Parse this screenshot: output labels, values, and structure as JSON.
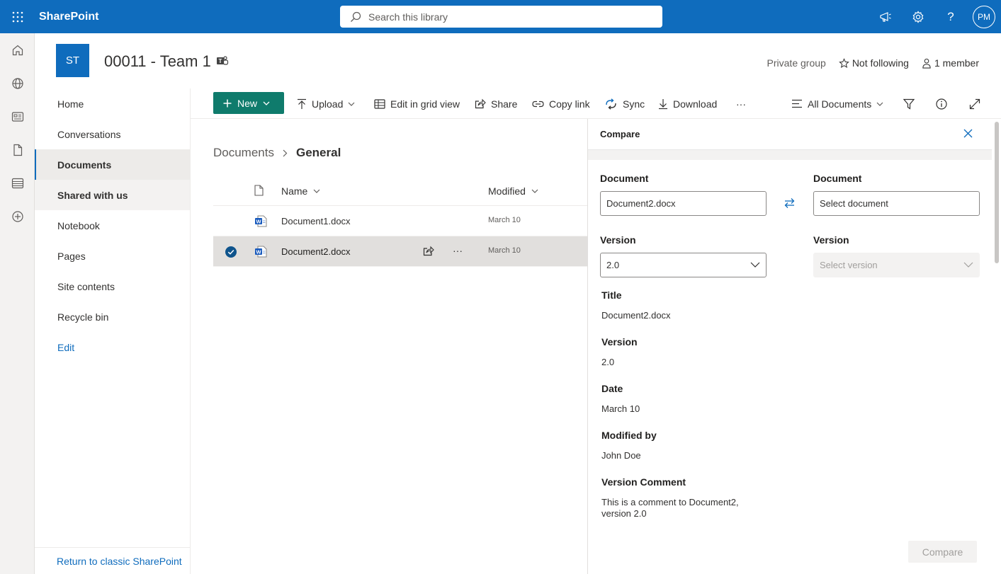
{
  "topbar": {
    "brand": "SharePoint",
    "search_placeholder": "Search this library",
    "user_initials": "PM"
  },
  "site": {
    "logo_initials": "ST",
    "title": "00011 - Team 1",
    "privacy": "Private group",
    "follow": "Not following",
    "members": "1 member"
  },
  "nav": {
    "items": [
      {
        "label": "Home"
      },
      {
        "label": "Conversations"
      },
      {
        "label": "Documents"
      },
      {
        "label": "Shared with us"
      },
      {
        "label": "Notebook"
      },
      {
        "label": "Pages"
      },
      {
        "label": "Site contents"
      },
      {
        "label": "Recycle bin"
      }
    ],
    "edit": "Edit",
    "classic": "Return to classic SharePoint"
  },
  "commandbar": {
    "new": "New",
    "upload": "Upload",
    "grid": "Edit in grid view",
    "share": "Share",
    "copy_link": "Copy link",
    "sync": "Sync",
    "download": "Download",
    "more": "···",
    "view": "All Documents"
  },
  "breadcrumb": {
    "root": "Documents",
    "current": "General"
  },
  "list": {
    "columns": {
      "name": "Name",
      "modified": "Modified"
    },
    "rows": [
      {
        "name": "Document1.docx",
        "modified": "March 10"
      },
      {
        "name": "Document2.docx",
        "modified": "March 10"
      }
    ]
  },
  "panel": {
    "title": "Compare",
    "left": {
      "doc_label": "Document",
      "doc_value": "Document2.docx",
      "ver_label": "Version",
      "ver_value": "2.0"
    },
    "right": {
      "doc_label": "Document",
      "doc_placeholder": "Select document",
      "ver_label": "Version",
      "ver_placeholder": "Select version"
    },
    "details": {
      "title_label": "Title",
      "title_value": "Document2.docx",
      "version_label": "Version",
      "version_value": "2.0",
      "date_label": "Date",
      "date_value": "March 10",
      "modified_by_label": "Modified by",
      "modified_by_value": "John Doe",
      "comment_label": "Version Comment",
      "comment_line1": "This is a comment to Document2,",
      "comment_line2": "version 2.0"
    },
    "compare_button": "Compare"
  },
  "colors": {
    "brand_blue": "#0f6cbd",
    "new_button": "#0f7b6c"
  }
}
